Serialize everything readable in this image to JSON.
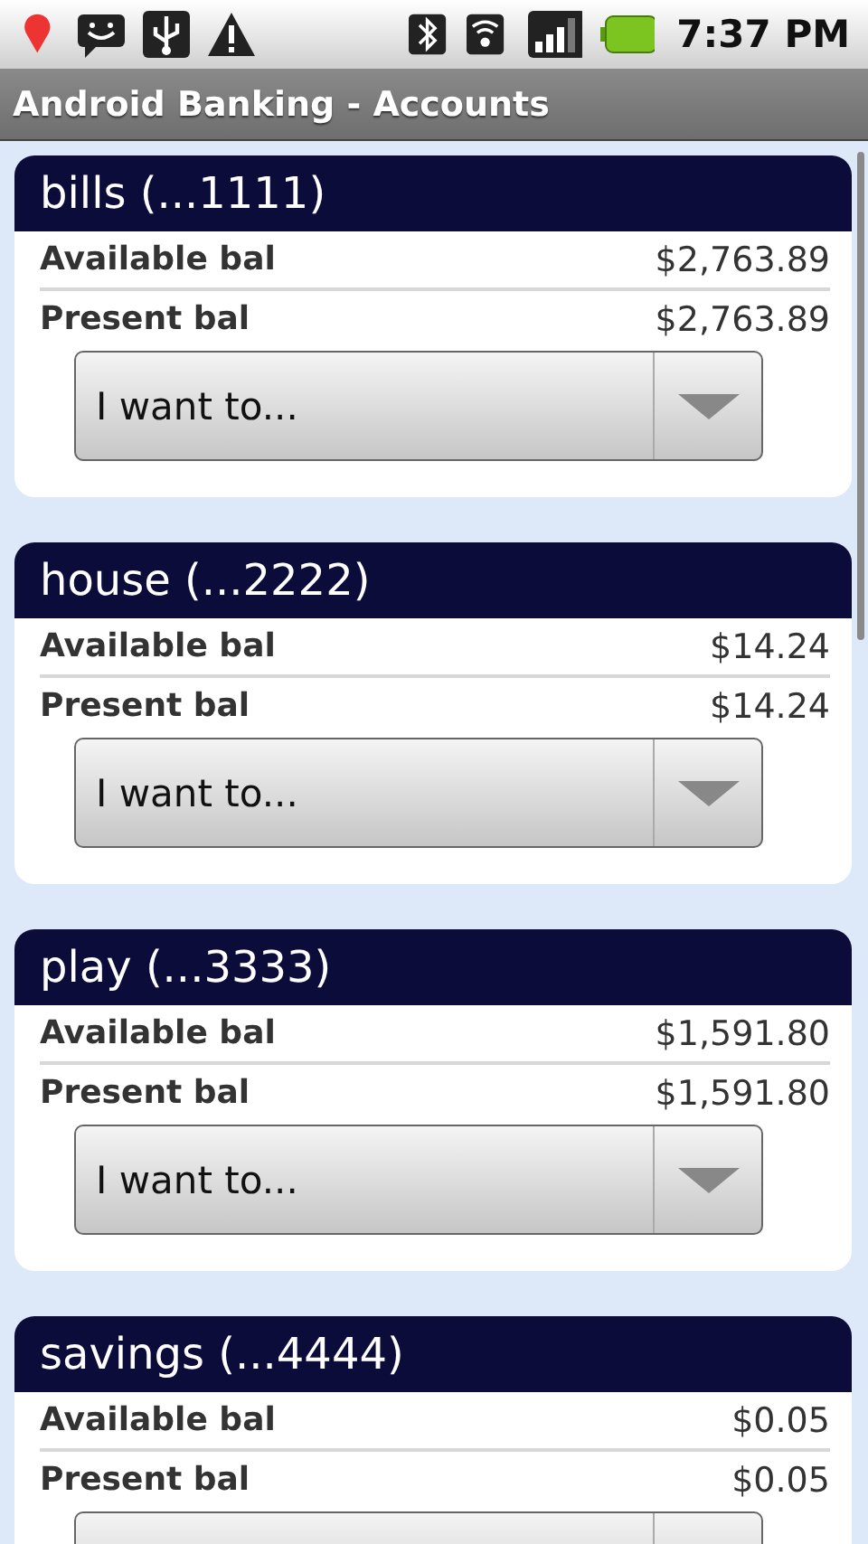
{
  "status_bar": {
    "time": "7:37 PM"
  },
  "title": "Android Banking - Accounts",
  "accounts": [
    {
      "name": "bills (...1111)",
      "balances": [
        {
          "label": "Available bal",
          "value": "$2,763.89"
        },
        {
          "label": "Present bal",
          "value": "$2,763.89"
        }
      ],
      "action": {
        "kind": "dropdown",
        "label": "I want to..."
      }
    },
    {
      "name": "house (...2222)",
      "balances": [
        {
          "label": "Available bal",
          "value": "$14.24"
        },
        {
          "label": "Present bal",
          "value": "$14.24"
        }
      ],
      "action": {
        "kind": "dropdown",
        "label": "I want to..."
      }
    },
    {
      "name": "play (...3333)",
      "balances": [
        {
          "label": "Available bal",
          "value": "$1,591.80"
        },
        {
          "label": "Present bal",
          "value": "$1,591.80"
        }
      ],
      "action": {
        "kind": "dropdown",
        "label": "I want to..."
      }
    },
    {
      "name": "savings (...4444)",
      "balances": [
        {
          "label": "Available bal",
          "value": "$0.05"
        },
        {
          "label": "Present bal",
          "value": "$0.05"
        }
      ],
      "action": {
        "kind": "dropdown"
      }
    }
  ]
}
